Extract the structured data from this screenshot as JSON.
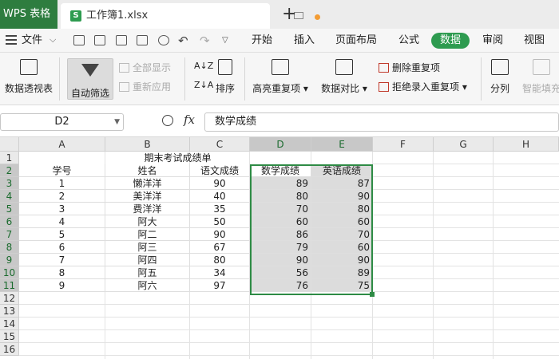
{
  "titlebar": {
    "app_tab": "WPS 表格",
    "file_tab": "工作簿1.xlsx"
  },
  "menubar": {
    "file_label": "文件",
    "items": [
      "开始",
      "插入",
      "页面布局",
      "公式",
      "数据",
      "审阅",
      "视图"
    ],
    "active_item": "数据"
  },
  "ribbon": {
    "pivot": "数据透视表",
    "autofilter": "自动筛选",
    "show_all": "全部显示",
    "reapply": "重新应用",
    "sort": "排序",
    "highlight_dup": "高亮重复项",
    "compare": "数据对比",
    "remove_dup": "删除重复项",
    "reject_dup": "拒绝录入重复项",
    "split": "分列",
    "smart_fill": "智能填充"
  },
  "formula_bar": {
    "name_box": "D2",
    "fx": "fx",
    "content": "数学成绩"
  },
  "sheet": {
    "columns": [
      "A",
      "B",
      "C",
      "D",
      "E",
      "F",
      "G",
      "H"
    ],
    "selected_columns": [
      "D",
      "E"
    ],
    "rows": [
      "1",
      "2",
      "3",
      "4",
      "5",
      "6",
      "7",
      "8",
      "9",
      "10",
      "11",
      "12",
      "13",
      "14",
      "15",
      "16"
    ],
    "title": "期末考试成绩单",
    "headers": [
      "学号",
      "姓名",
      "语文成绩",
      "数学成绩",
      "英语成绩"
    ],
    "records": [
      [
        "1",
        "懒洋洋",
        "90",
        "89",
        "87"
      ],
      [
        "2",
        "美洋洋",
        "40",
        "80",
        "90"
      ],
      [
        "3",
        "费洋洋",
        "35",
        "70",
        "80"
      ],
      [
        "4",
        "阿大",
        "50",
        "60",
        "60"
      ],
      [
        "5",
        "阿二",
        "90",
        "86",
        "70"
      ],
      [
        "6",
        "阿三",
        "67",
        "79",
        "60"
      ],
      [
        "7",
        "阿四",
        "80",
        "90",
        "90"
      ],
      [
        "8",
        "阿五",
        "34",
        "56",
        "89"
      ],
      [
        "9",
        "阿六",
        "97",
        "76",
        "75"
      ]
    ]
  },
  "colors": {
    "accent": "#2e9b50",
    "selection_border": "#2e8b45"
  }
}
